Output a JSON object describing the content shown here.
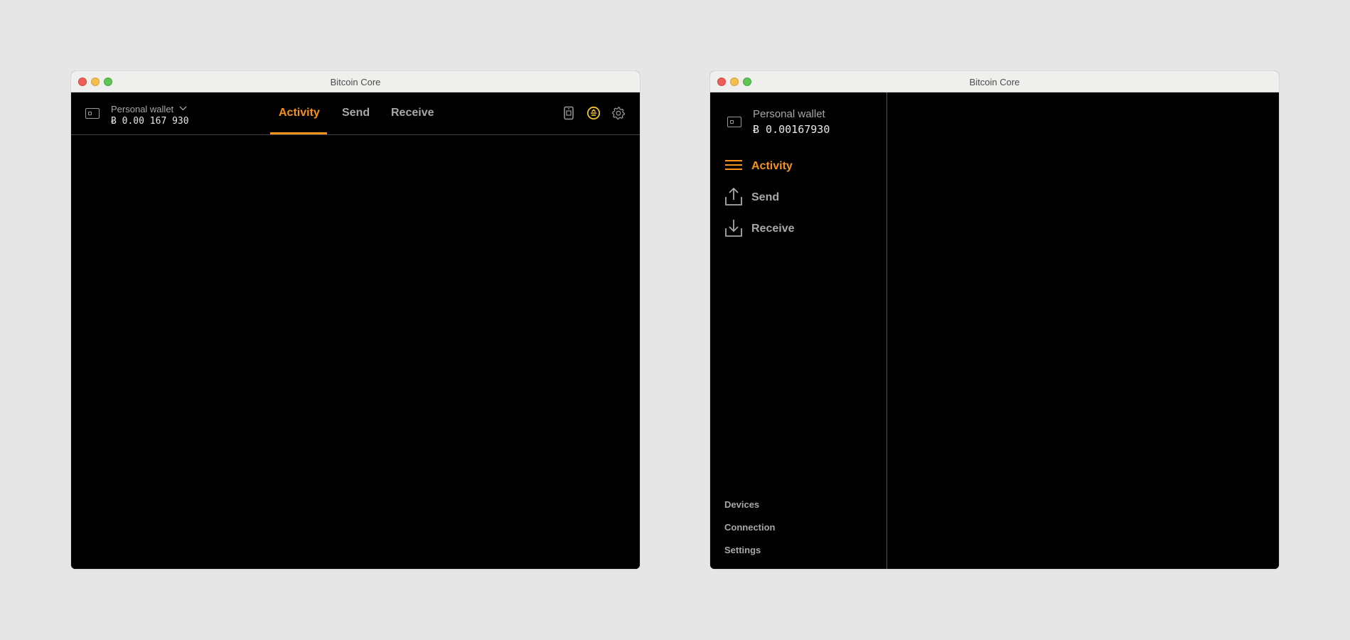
{
  "left_window": {
    "title": "Bitcoin Core",
    "wallet": {
      "name": "Personal wallet",
      "balance": "Ƀ 0.00 167 930"
    },
    "tabs": [
      {
        "label": "Activity",
        "active": true
      },
      {
        "label": "Send",
        "active": false
      },
      {
        "label": "Receive",
        "active": false
      }
    ],
    "header_icons": [
      "device-icon",
      "network-status-icon",
      "gear-icon"
    ]
  },
  "right_window": {
    "title": "Bitcoin Core",
    "wallet": {
      "name": "Personal wallet",
      "balance": "Ƀ 0.00167930"
    },
    "nav": [
      {
        "label": "Activity",
        "icon": "activity-list-icon",
        "active": true
      },
      {
        "label": "Send",
        "icon": "send-upload-icon",
        "active": false
      },
      {
        "label": "Receive",
        "icon": "receive-download-icon",
        "active": false
      }
    ],
    "footer": [
      "Devices",
      "Connection",
      "Settings"
    ]
  },
  "colors": {
    "accent": "#f7931a",
    "status_yellow": "#f2c12e",
    "window_bg": "#000000",
    "desktop_bg": "#e6e6e6",
    "text_muted": "#a8a8a8"
  }
}
